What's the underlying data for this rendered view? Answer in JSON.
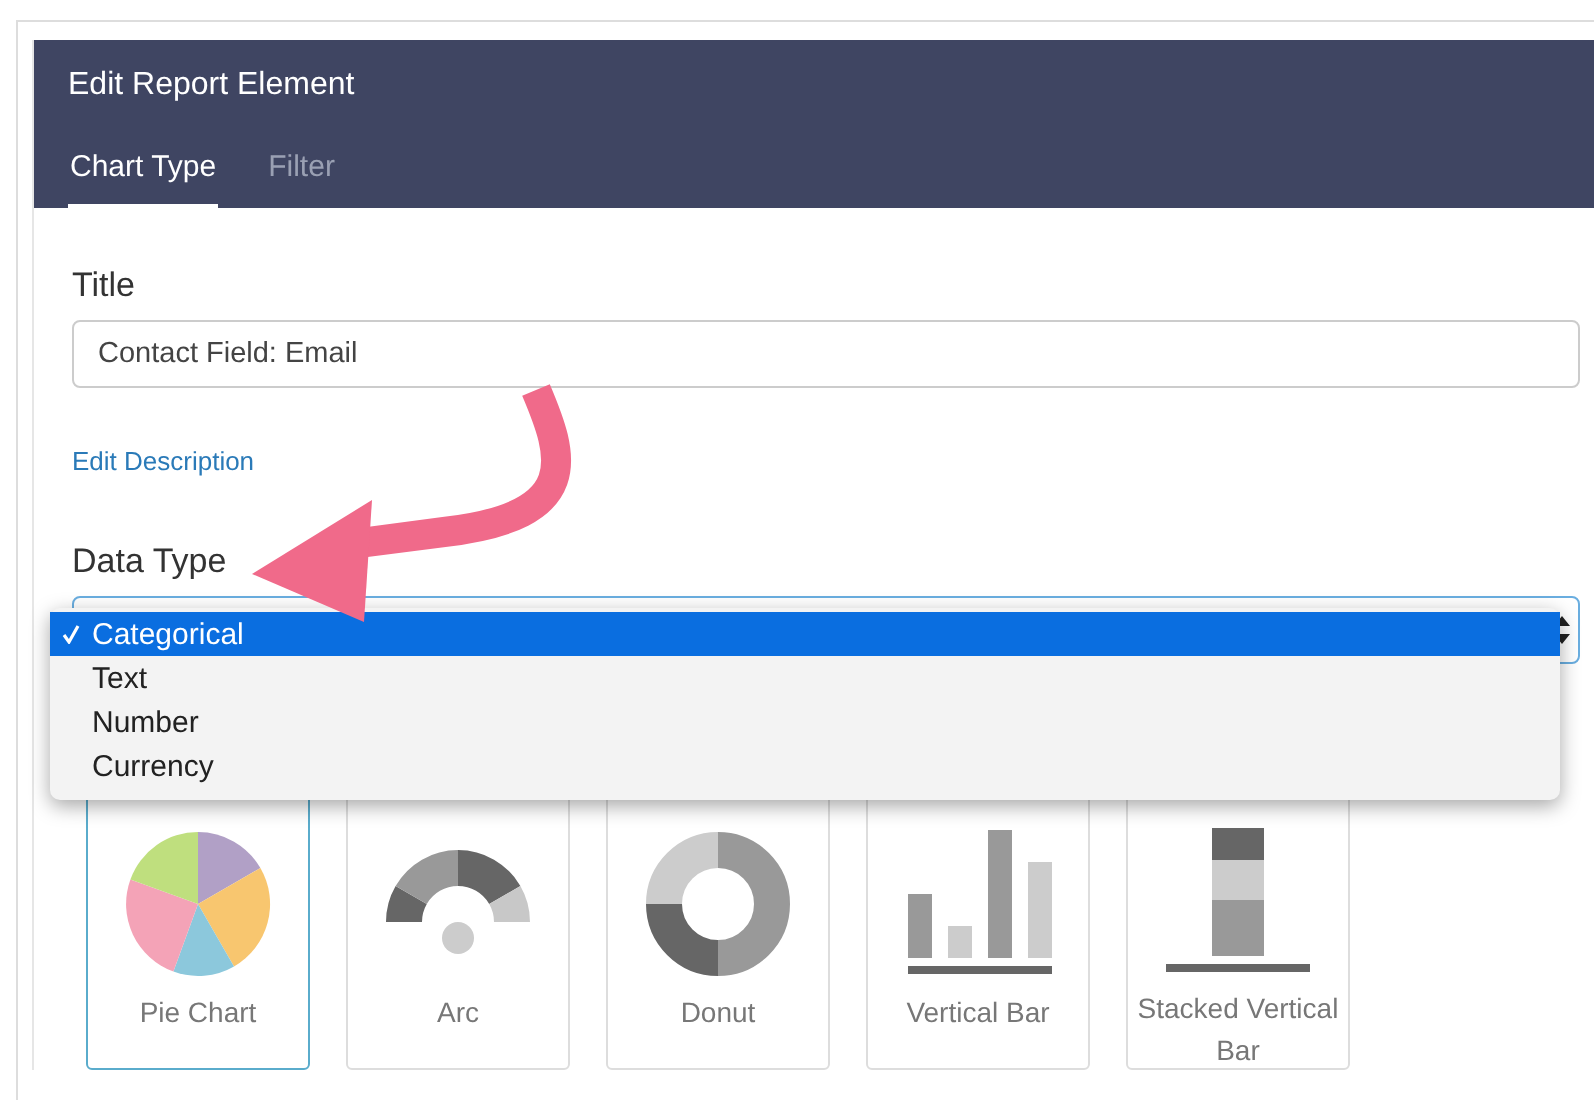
{
  "window": {
    "title": "Edit Report Element"
  },
  "tabs": [
    {
      "label": "Chart Type",
      "selected": true
    },
    {
      "label": "Filter",
      "selected": false
    }
  ],
  "title_field": {
    "label": "Title",
    "value": "Contact Field: Email"
  },
  "edit_description_link": "Edit Description",
  "data_type": {
    "label": "Data Type",
    "expanded": true,
    "options": [
      {
        "label": "Categorical",
        "selected": true
      },
      {
        "label": "Text",
        "selected": false
      },
      {
        "label": "Number",
        "selected": false
      },
      {
        "label": "Currency",
        "selected": false
      }
    ]
  },
  "chart_types": [
    {
      "label": "Pie Chart",
      "kind": "pie",
      "selected": true
    },
    {
      "label": "Arc",
      "kind": "arc",
      "selected": false
    },
    {
      "label": "Donut",
      "kind": "donut",
      "selected": false
    },
    {
      "label": "Vertical Bar",
      "kind": "vertical-bar",
      "selected": false
    },
    {
      "label": "Stacked Vertical Bar",
      "kind": "stacked-bar",
      "selected": false
    }
  ]
}
